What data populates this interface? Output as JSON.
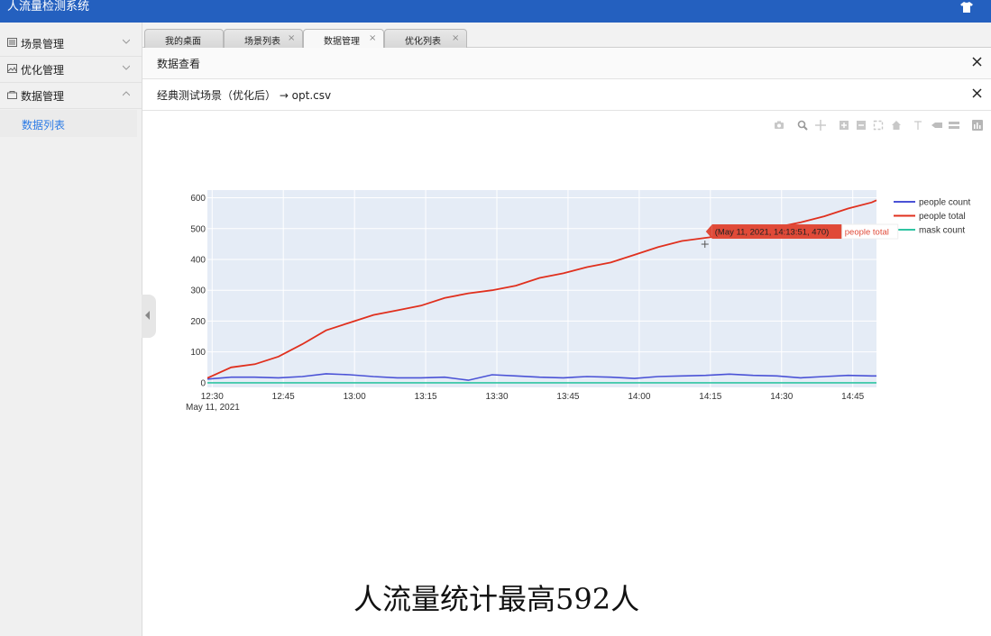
{
  "app": {
    "title": "人流量检测系统"
  },
  "sidebar": {
    "items": [
      {
        "label": "场景管理",
        "icon": "list-icon",
        "expanded": false
      },
      {
        "label": "优化管理",
        "icon": "image-icon",
        "expanded": false
      },
      {
        "label": "数据管理",
        "icon": "bag-icon",
        "expanded": true
      }
    ],
    "subitems": [
      {
        "label": "数据列表"
      }
    ]
  },
  "tabs": [
    {
      "label": "我的桌面",
      "closable": false,
      "active": false
    },
    {
      "label": "场景列表",
      "closable": true,
      "active": false
    },
    {
      "label": "数据管理",
      "closable": true,
      "active": true
    },
    {
      "label": "优化列表",
      "closable": true,
      "active": false
    }
  ],
  "panel": {
    "title": "数据查看",
    "subtitle": "经典测试场景（优化后） → opt.csv"
  },
  "chart_data": {
    "type": "line",
    "x_start": "2021-05-11 12:29",
    "x_end": "2021-05-11 14:50",
    "x_ticks": [
      "12:30",
      "12:45",
      "13:00",
      "13:15",
      "13:30",
      "13:45",
      "14:00",
      "14:15",
      "14:30",
      "14:45"
    ],
    "x_date_label": "May 11, 2021",
    "ylim": [
      -15,
      625
    ],
    "y_ticks": [
      0,
      100,
      200,
      300,
      400,
      500,
      600
    ],
    "grid": true,
    "legend_position": "right",
    "x_minutes": [
      0,
      5,
      10,
      15,
      20,
      25,
      30,
      35,
      40,
      45,
      50,
      55,
      60,
      65,
      70,
      75,
      80,
      85,
      90,
      95,
      100,
      105,
      110,
      115,
      120,
      125,
      130,
      135,
      140,
      141
    ],
    "series": [
      {
        "name": "people count",
        "color": "#4a52d6",
        "values": [
          12,
          18,
          18,
          16,
          20,
          29,
          26,
          20,
          16,
          16,
          18,
          8,
          26,
          22,
          18,
          16,
          20,
          18,
          14,
          20,
          22,
          24,
          28,
          24,
          22,
          16,
          20,
          24,
          22,
          22
        ]
      },
      {
        "name": "people total",
        "color": "#e0301e",
        "values": [
          15,
          50,
          60,
          85,
          125,
          170,
          195,
          220,
          235,
          250,
          275,
          290,
          300,
          315,
          340,
          355,
          375,
          390,
          415,
          440,
          460,
          470,
          480,
          495,
          505,
          520,
          540,
          565,
          585,
          592
        ]
      },
      {
        "name": "mask count",
        "color": "#2fc4a2",
        "values": [
          0,
          0,
          0,
          0,
          0,
          0,
          0,
          0,
          0,
          0,
          0,
          0,
          0,
          0,
          0,
          0,
          0,
          0,
          0,
          0,
          0,
          0,
          0,
          0,
          0,
          0,
          0,
          0,
          0,
          0
        ]
      }
    ],
    "tooltip": {
      "text": "(May 11, 2021, 14:13:51, 470)",
      "series_label": "people total",
      "color": "#e04a38"
    }
  },
  "caption": "人流量统计最高592人"
}
